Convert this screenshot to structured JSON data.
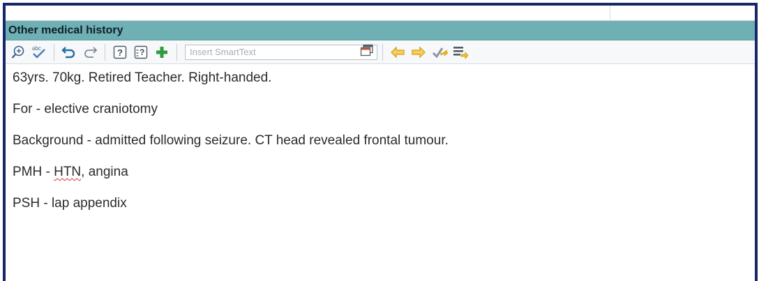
{
  "section": {
    "title": "Other medical history"
  },
  "toolbar": {
    "icons": [
      "zoom-icon",
      "spellcheck-icon",
      "undo-icon",
      "redo-icon",
      "help-icon",
      "help-list-icon",
      "add-icon",
      "insert-smarttext-icon",
      "previous-icon",
      "next-icon",
      "accept-icon",
      "insert-list-icon"
    ],
    "smarttext_placeholder": "Insert SmartText"
  },
  "note": {
    "line1": "63yrs. 70kg. Retired Teacher. Right-handed.",
    "line2": "For - elective craniotomy",
    "line3": "Background - admitted following seizure. CT head revealed frontal tumour.",
    "line4_prefix": "PMH - ",
    "line4_flagged": "HTN",
    "line4_suffix": ", angina",
    "line5": "PSH - lap appendix"
  },
  "colors": {
    "header": "#6fb0b4",
    "frame": "#16276a",
    "accent_arrow": "#e8b418",
    "add": "#2f9a3e",
    "undo": "#1f6fa8"
  }
}
